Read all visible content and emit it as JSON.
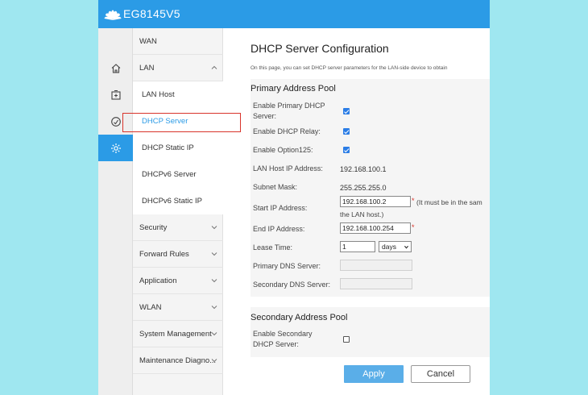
{
  "header": {
    "product_name": "EG8145V5",
    "logo_icon": "huawei-flower-icon",
    "bar_color": "#2b9be6"
  },
  "iconbar": [
    {
      "icon": "home-icon",
      "active": false
    },
    {
      "icon": "add-box-icon",
      "active": false
    },
    {
      "icon": "speedometer-icon",
      "active": false
    },
    {
      "icon": "gear-icon",
      "active": true
    }
  ],
  "menu": {
    "wan": "WAN",
    "lan": "LAN",
    "lan_children": [
      "LAN Host",
      "DHCP Server",
      "DHCP Static IP",
      "DHCPv6 Server",
      "DHCPv6 Static IP"
    ],
    "security": "Security",
    "forward_rules": "Forward Rules",
    "application": "Application",
    "wlan": "WLAN",
    "system_management": "System Management",
    "maintenance": "Maintenance Diagno..."
  },
  "page": {
    "title": "DHCP Server Configuration",
    "description": "On this page, you can set DHCP server parameters for the LAN-side device to obtain",
    "primary": {
      "title": "Primary Address Pool",
      "enable_primary_label": "Enable Primary DHCP Server:",
      "enable_relay_label": "Enable DHCP Relay:",
      "enable_opt125_label": "Enable Option125:",
      "lan_ip_label": "LAN Host IP Address:",
      "lan_ip_value": "192.168.100.1",
      "subnet_label": "Subnet Mask:",
      "subnet_value": "255.255.255.0",
      "start_ip_label": "Start IP Address:",
      "start_ip_value": "192.168.100.2",
      "start_ip_note1": "(It must be in the sam",
      "start_ip_note2": "the LAN host.)",
      "end_ip_label": "End IP Address:",
      "end_ip_value": "192.168.100.254",
      "lease_label": "Lease Time:",
      "lease_value": "1",
      "lease_unit": "days",
      "primary_dns_label": "Primary DNS Server:",
      "primary_dns_value": "",
      "secondary_dns_label": "Secondary DNS Server:",
      "secondary_dns_value": "",
      "required_mark": "*"
    },
    "secondary": {
      "title": "Secondary Address Pool",
      "enable_secondary_label": "Enable Secondary DHCP Server:"
    },
    "buttons": {
      "apply": "Apply",
      "cancel": "Cancel"
    }
  }
}
